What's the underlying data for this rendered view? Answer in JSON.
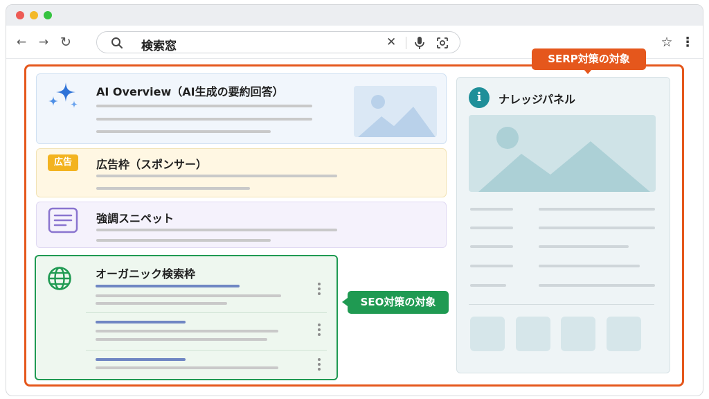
{
  "browser": {
    "search_query": "検索窓",
    "buttons": {
      "back": "←",
      "forward": "→",
      "reload": "↻",
      "clear": "✕",
      "bookmark": "☆",
      "menu": "⋮"
    }
  },
  "labels": {
    "serp_target": "SERP対策の対象",
    "seo_target": "SEO対策の対象"
  },
  "cards": {
    "ai_overview": {
      "title": "AI Overview（AI生成の要約回答）"
    },
    "ads": {
      "tag": "広告",
      "title": "広告枠（スポンサー）"
    },
    "featured_snippet": {
      "title": "強調スニペット"
    },
    "organic": {
      "title": "オーガニック検索枠"
    }
  },
  "knowledge_panel": {
    "title": "ナレッジパネル",
    "icon_glyph": "i"
  },
  "colors": {
    "serp_accent": "#e5571c",
    "seo_accent": "#1f9a52",
    "ai_card_bg": "#f1f6fc",
    "ad_card_bg": "#fff7e3",
    "snippet_card_bg": "#f5f2fc",
    "organic_card_bg": "#eef7ef",
    "knowledge_bg": "#eef4f6"
  },
  "icons": [
    "sparkle-icon",
    "ad-tag-icon",
    "document-icon",
    "globe-icon",
    "info-icon",
    "image-placeholder-icon",
    "search-icon",
    "mic-icon",
    "lens-icon",
    "star-icon",
    "kebab-menu-icon"
  ]
}
